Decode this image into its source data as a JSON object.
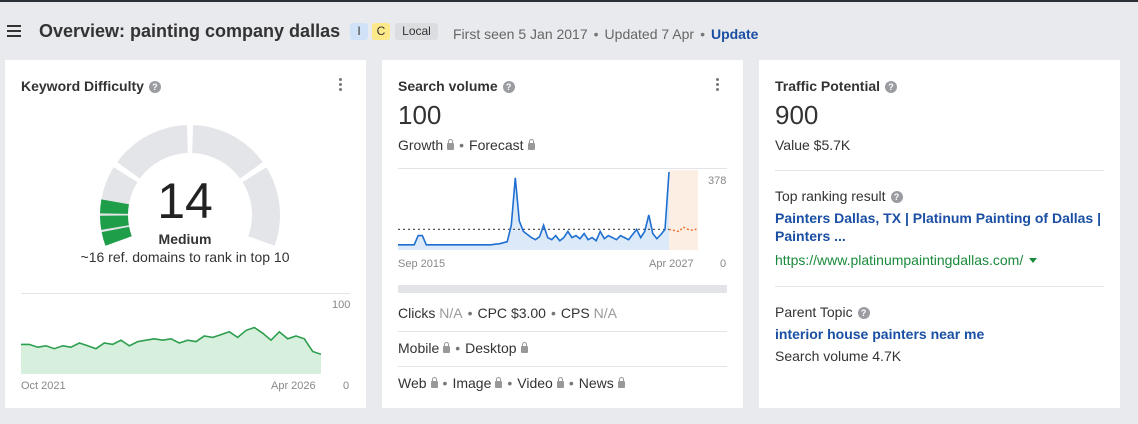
{
  "header": {
    "title": "Overview: painting company dallas",
    "badges": [
      "I",
      "C",
      "Local"
    ],
    "first_seen": "First seen 5 Jan 2017",
    "updated": "Updated 7 Apr",
    "update_label": "Update",
    "separator": "•"
  },
  "kd_card": {
    "title": "Keyword Difficulty",
    "value": "14",
    "level": "Medium",
    "subtitle": "~16 ref. domains to rank in top 10",
    "chart": {
      "y_max_label": "100",
      "y_min_label": "0",
      "x_start_label": "Oct 2021",
      "x_end_label": "Apr 2026"
    },
    "accent_color": "#1f9e4a"
  },
  "sv_card": {
    "title": "Search volume",
    "value": "100",
    "growth_label": "Growth",
    "forecast_label": "Forecast",
    "chart": {
      "y_max_label": "378",
      "y_min_label": "0",
      "x_start_label": "Sep 2015",
      "x_end_label": "Apr 2027"
    },
    "clicks_label": "Clicks",
    "clicks_value": "N/A",
    "cpc_label": "CPC",
    "cpc_value": "$3.00",
    "cps_label": "CPS",
    "cps_value": "N/A",
    "mobile_label": "Mobile",
    "desktop_label": "Desktop",
    "web_label": "Web",
    "image_label": "Image",
    "video_label": "Video",
    "news_label": "News",
    "separator": "•",
    "line_color": "#1f6fd1",
    "forecast_color": "#e8702a"
  },
  "tp_card": {
    "title": "Traffic Potential",
    "value": "900",
    "value_line": "Value $5.7K",
    "top_result_label": "Top ranking result",
    "top_result_title": "Painters Dallas, TX | Platinum Painting of Dallas | Painters ...",
    "top_result_url": "https://www.platinumpaintingdallas.com/",
    "parent_topic_label": "Parent Topic",
    "parent_topic": "interior house painters near me",
    "parent_volume": "Search volume 4.7K"
  },
  "chart_data": [
    {
      "type": "area",
      "series": [
        {
          "values": [
            21,
            21,
            19,
            20,
            18,
            20,
            19,
            22,
            20,
            18,
            22,
            21,
            24,
            20,
            23,
            24,
            25,
            24,
            25,
            22,
            24,
            23,
            27,
            26,
            28,
            30,
            26,
            31,
            33,
            29,
            24,
            30,
            25,
            27,
            25,
            16,
            14
          ]
        }
      ],
      "xlabel": "",
      "ylabel": "",
      "ylim": [
        0,
        100
      ],
      "x_range": [
        "Oct 2021",
        "Apr 2026"
      ]
    },
    {
      "type": "line",
      "series": [
        {
          "values": [
            25,
            25,
            25,
            25,
            25,
            70,
            70,
            25,
            25,
            25,
            25,
            25,
            25,
            25,
            25,
            25,
            25,
            25,
            25,
            25,
            25,
            25,
            25,
            25,
            28,
            30,
            35,
            40,
            120,
            350,
            140,
            90,
            75,
            60,
            50,
            65,
            120,
            60,
            50,
            70,
            45,
            60,
            90,
            60,
            70,
            55,
            80,
            50,
            60,
            45,
            90,
            55,
            70,
            60,
            50,
            70,
            60,
            50,
            75,
            100,
            60,
            90,
            170,
            80,
            55,
            75,
            100,
            378
          ]
        },
        {
          "values": [
            100,
            95,
            90,
            110,
            100,
            95,
            105
          ]
        }
      ],
      "avg_dotted": 100,
      "xlabel": "",
      "ylabel": "",
      "ylim": [
        0,
        378
      ],
      "x_range": [
        "Sep 2015",
        "Apr 2027"
      ]
    }
  ]
}
